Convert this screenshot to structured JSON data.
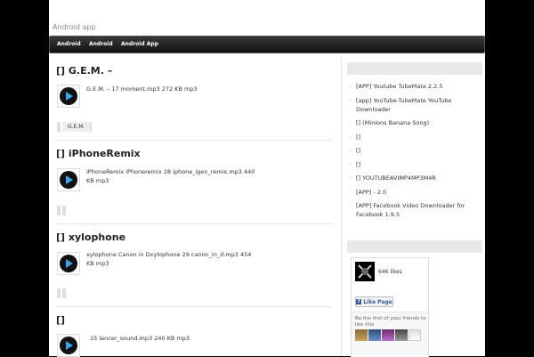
{
  "site": {
    "title": "Android app"
  },
  "nav": {
    "items": [
      "Android",
      "Android",
      "Android App"
    ]
  },
  "posts": [
    {
      "title": "[] G.E.M. –",
      "meta": "G.E.M. – 17 moment.mp3 272 KB mp3",
      "tag": "G.E.M."
    },
    {
      "title": "[] iPhoneRemix",
      "meta": "iPhoneRemix iPhoneremix 28 iphone_igen_remix.mp3 440 KB mp3",
      "tag": ""
    },
    {
      "title": "[] xylophone",
      "meta": "xylophone Canon in Dxylophone 29 canon_in_d.mp3 454 KB mp3",
      "tag": ""
    },
    {
      "title": "[]",
      "meta": "15 lancer_sound.mp3 240 KB mp3",
      "tag": ""
    }
  ],
  "sidebar": {
    "recent": [
      "[APP] Youtube TubeMate 2.2.5",
      "[app] YouTube-TubeMate YouTube Downloader",
      "[] (Minions Banana Song)",
      "[]",
      "[]",
      "[]",
      "[] YOUTUBEAVIMP4MP3M4R",
      "[APP] - 2.0",
      "[APP] Facebook Video Downloader for Facebook 1.9.5"
    ],
    "facebook": {
      "likes": "646 likes",
      "like_button": "Like Page",
      "friends_text": "Be the first of your friends to like this"
    }
  },
  "colors": {
    "accent": "#39a7e6",
    "nav_bg": "#1a1a1a",
    "fb_blue": "#3b5998"
  }
}
